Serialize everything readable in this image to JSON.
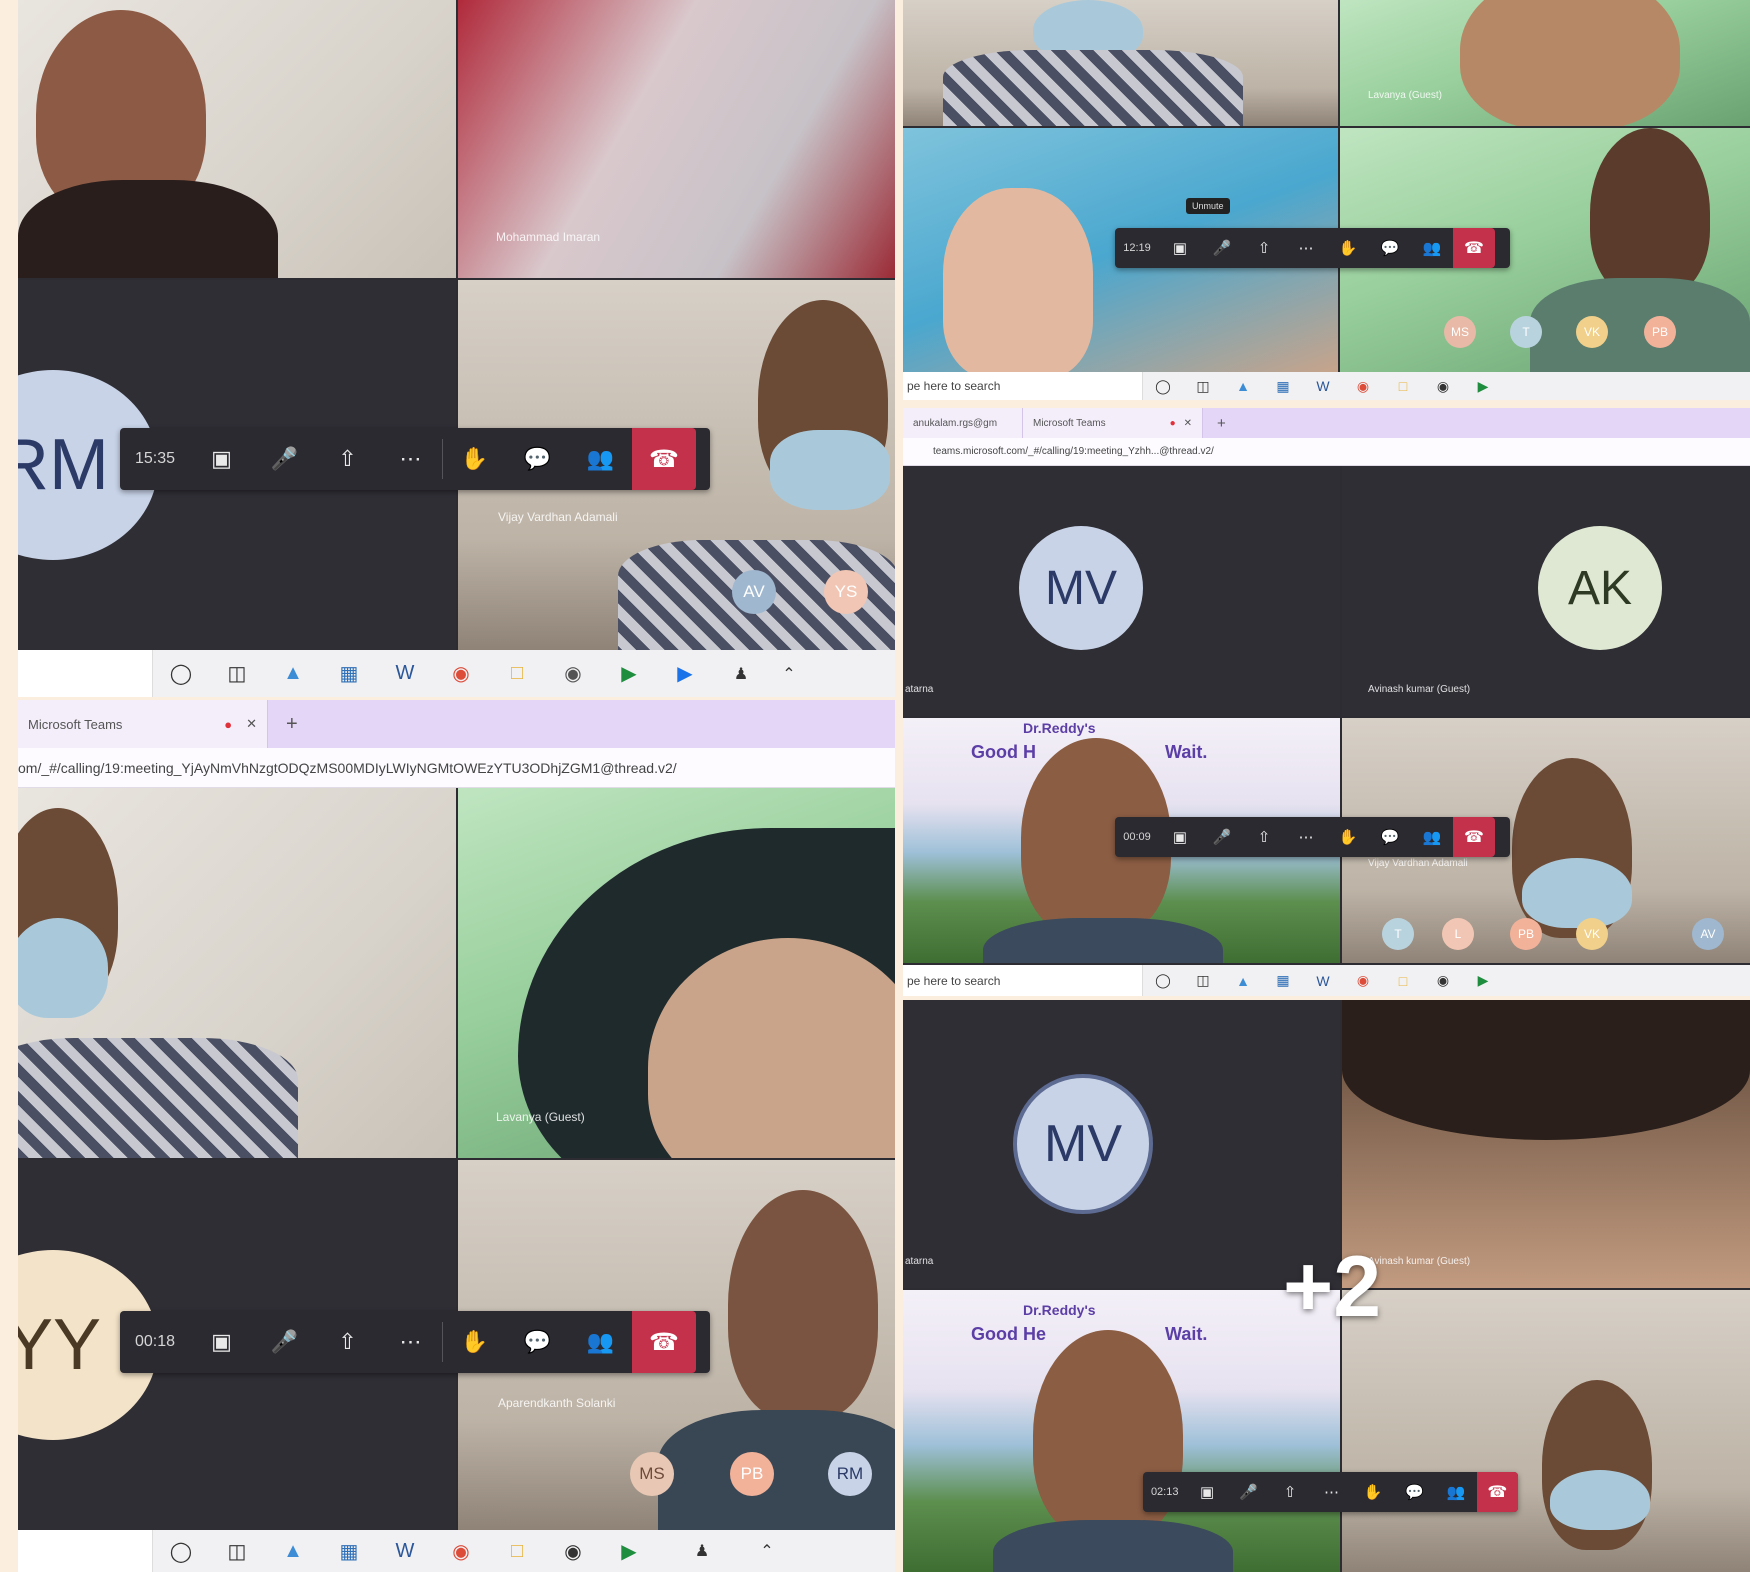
{
  "q1": {
    "tile_name_top_right": "Mohammad Imaran",
    "avatar_initials": "RM",
    "tile_name_bottom_right": "Vijay Vardhan Adamali",
    "timer": "15:35",
    "participants": [
      "AV",
      "YS"
    ]
  },
  "q2": {
    "tile_name_top_right": "Lavanya (Guest)",
    "timer": "12:19",
    "tooltip": "Unmute",
    "participants": [
      "MS",
      "T",
      "VK",
      "PB"
    ],
    "search_placeholder": "pe here to search"
  },
  "q3": {
    "tab_label": "Microsoft Teams",
    "url": "om/_#/calling/19:meeting_YjAyNmVhNzgtODQzMS00MDIyLWIyNGMtOWEzYTU3ODhjZGM1@thread.v2/",
    "tile_name_top_right": "Lavanya (Guest)",
    "avatar_initials": "YY",
    "timer": "00:18",
    "tile_name_bottom_right": "Aparendkanth Solanki",
    "participants": [
      "MS",
      "PB",
      "RM"
    ]
  },
  "q4": {
    "tab_1": "anukalam.rgs@gm",
    "tab_2": "Microsoft Teams",
    "url": "teams.microsoft.com/_#/calling/19:meeting_Yzhh...@thread.v2/",
    "avatar_left": "MV",
    "avatar_right": "AK",
    "name_left": "atarna",
    "name_right": "Avinash kumar (Guest)",
    "banner_brand": "Dr.Reddy's",
    "banner_text_left": "Good H",
    "banner_text_right": "Wait.",
    "timer": "00:09",
    "tile_name_right": "Vijay Vardhan Adamali",
    "participants": [
      "T",
      "L",
      "PB",
      "VK",
      "AV"
    ],
    "search_placeholder": "pe here to search"
  },
  "q5": {
    "avatar": "MV",
    "name_left": "atarna",
    "name_right": "Avinash kumar (Guest)",
    "more": "+2",
    "banner_brand": "Dr.Reddy's",
    "banner_text_left": "Good He",
    "banner_text_right": "Wait.",
    "timer": "02:13"
  },
  "colors": {
    "hangup": "#c4314b",
    "teams_bar": "#2b2a30",
    "avatar_bg": "#c8d3e8",
    "background": "#fbeede"
  }
}
